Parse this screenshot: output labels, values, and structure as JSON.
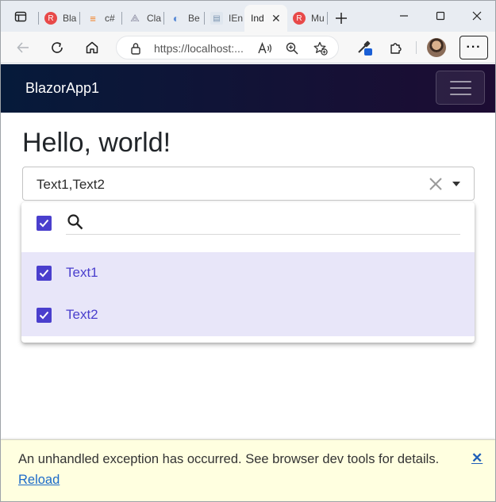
{
  "browser": {
    "tabs": [
      {
        "title": "Bla",
        "icon": "radzen-icon",
        "color": "#e84949"
      },
      {
        "title": "c#",
        "icon": "stackoverflow-icon",
        "color": "#f48024"
      },
      {
        "title": "Cla",
        "icon": "page-icon",
        "color": "#8a8aa0"
      },
      {
        "title": "Be",
        "icon": "blazor-icon",
        "color": "#5b8bd6"
      },
      {
        "title": "IEn",
        "icon": "doc-icon",
        "color": "#a0b4c8"
      },
      {
        "title": "Ind",
        "icon": "page-icon",
        "color": "#cccccc"
      },
      {
        "title": "Mu",
        "icon": "radzen-icon",
        "color": "#e84949"
      }
    ],
    "active_tab_close": "✕",
    "url": "https://localhost:..."
  },
  "app": {
    "brand": "BlazorApp1",
    "page_title": "Hello, world!",
    "select": {
      "value": "Text1,Text2",
      "search_placeholder": ""
    },
    "options": [
      {
        "label": "Text1",
        "checked": true
      },
      {
        "label": "Text2",
        "checked": true
      }
    ],
    "error": {
      "message": "An unhandled exception has occurred. See browser dev tools for details.",
      "reload": "Reload",
      "dismiss": "✕"
    }
  },
  "colors": {
    "accent": "#4a3fcd",
    "selected_row": "#e8e6f9",
    "navbar_start": "#061a3a",
    "navbar_end": "#1d0c33",
    "error_bg": "#ffffe0"
  }
}
